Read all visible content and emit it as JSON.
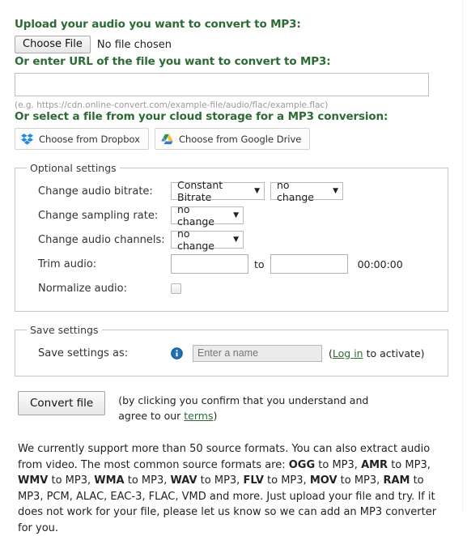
{
  "upload": {
    "heading": "Upload your audio you want to convert to MP3:",
    "choose_file_label": "Choose File",
    "no_file_text": "No file chosen"
  },
  "url": {
    "heading": "Or enter URL of the file you want to convert to MP3:",
    "value": "",
    "placeholder": "",
    "hint": "(e.g. https://cdn.online-convert.com/example-file/audio/flac/example.flac)"
  },
  "cloud": {
    "heading": "Or select a file from your cloud storage for a MP3 conversion:",
    "dropbox_label": "Choose from Dropbox",
    "gdrive_label": "Choose from Google Drive"
  },
  "optional_settings": {
    "legend": "Optional settings",
    "rows": {
      "bitrate_label": "Change audio bitrate:",
      "bitrate_value": "Constant Bitrate",
      "bitrate_second_value": "no change",
      "sampling_label": "Change sampling rate:",
      "sampling_value": "no change",
      "channels_label": "Change audio channels:",
      "channels_value": "no change",
      "trim_label": "Trim audio:",
      "trim_from_value": "",
      "trim_to_word": "to",
      "trim_to_value": "",
      "trim_duration": "00:00:00",
      "normalize_label": "Normalize audio:"
    },
    "arrow_glyph": "▼"
  },
  "save_settings": {
    "legend": "Save settings",
    "label": "Save settings as:",
    "name_value": "",
    "name_placeholder": "Enter a name",
    "note_prefix": "(",
    "note_link": "Log in",
    "note_suffix": " to activate)"
  },
  "convert": {
    "button_label": "Convert file",
    "terms_line1": "(by clicking you confirm that you understand and",
    "terms_line2_prefix": "agree to our ",
    "terms_link": "terms",
    "terms_line2_suffix": ")"
  },
  "footer": {
    "part1": "We currently support more than 50 source formats. You can also extract audio from video. The most common source formats are: ",
    "f1": "OGG",
    "s1": " to MP3, ",
    "f2": "AMR",
    "s2": " to MP3, ",
    "f3": "WMV",
    "s3": " to MP3, ",
    "f4": "WMA",
    "s4": " to MP3, ",
    "f5": "WAV",
    "s5": " to MP3, ",
    "f6": "FLV",
    "s6": " to MP3, ",
    "f7": "MOV",
    "s7": " to MP3, ",
    "f8": "RAM",
    "s8": " to MP3, PCM, ALAC, EAC-3, FLAC, VMD and more. Just upload your file and try. If it does not work for your file, please let us know so we can add an MP3 converter for you."
  },
  "colors": {
    "heading_green": "#2c6b36",
    "link_green": "#2c6b36",
    "dropbox_blue": "#1e8ae6",
    "info_blue": "#1f6fb5"
  }
}
